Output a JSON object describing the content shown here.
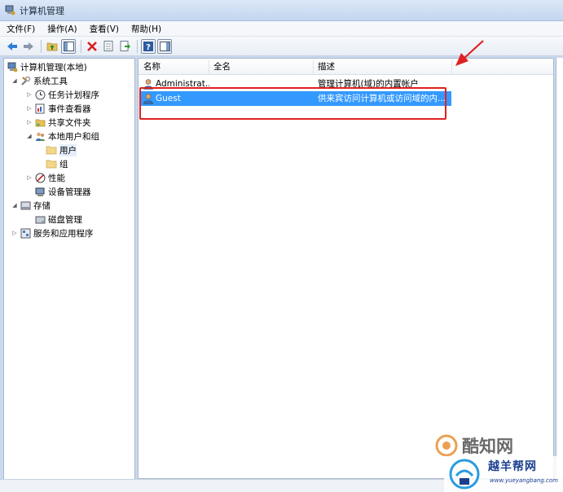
{
  "window": {
    "title": "计算机管理"
  },
  "menu": [
    {
      "label": "文件(F)"
    },
    {
      "label": "操作(A)"
    },
    {
      "label": "查看(V)"
    },
    {
      "label": "帮助(H)"
    }
  ],
  "toolbar": [
    {
      "icon": "back-arrow-icon"
    },
    {
      "icon": "forward-arrow-icon"
    },
    {
      "icon": "up-folder-icon"
    },
    {
      "icon": "show-hide-tree-icon"
    },
    {
      "icon": "delete-icon"
    },
    {
      "icon": "properties-icon"
    },
    {
      "icon": "export-list-icon"
    },
    {
      "icon": "help-icon"
    },
    {
      "icon": "action-pane-icon"
    }
  ],
  "tree": [
    {
      "label": "计算机管理(本地)",
      "icon": "computer-management-icon"
    },
    {
      "label": "系统工具",
      "icon": "system-tools-icon"
    },
    {
      "label": "任务计划程序",
      "icon": "task-scheduler-icon"
    },
    {
      "label": "事件查看器",
      "icon": "event-viewer-icon"
    },
    {
      "label": "共享文件夹",
      "icon": "shared-folders-icon"
    },
    {
      "label": "本地用户和组",
      "icon": "local-users-groups-icon"
    },
    {
      "label": "用户",
      "icon": "folder-icon"
    },
    {
      "label": "组",
      "icon": "folder-icon"
    },
    {
      "label": "性能",
      "icon": "performance-icon"
    },
    {
      "label": "设备管理器",
      "icon": "device-manager-icon"
    },
    {
      "label": "存储",
      "icon": "storage-icon"
    },
    {
      "label": "磁盘管理",
      "icon": "disk-management-icon"
    },
    {
      "label": "服务和应用程序",
      "icon": "services-apps-icon"
    }
  ],
  "list": {
    "columns": [
      "名称",
      "全名",
      "描述"
    ],
    "rows": [
      {
        "name": "Administrat...",
        "full_name": "",
        "description": "管理计算机(域)的内置帐户",
        "selected": false
      },
      {
        "name": "Guest",
        "full_name": "",
        "description": "供来宾访问计算机或访问域的内...",
        "selected": true
      }
    ]
  },
  "colors": {
    "selection": "#3399ff",
    "annotation_red": "#e02020"
  },
  "watermarks": {
    "kuzhi": "酷知网",
    "yueyang": "越羊帮网",
    "yueyang_url": "www.yueyangbang.com"
  }
}
